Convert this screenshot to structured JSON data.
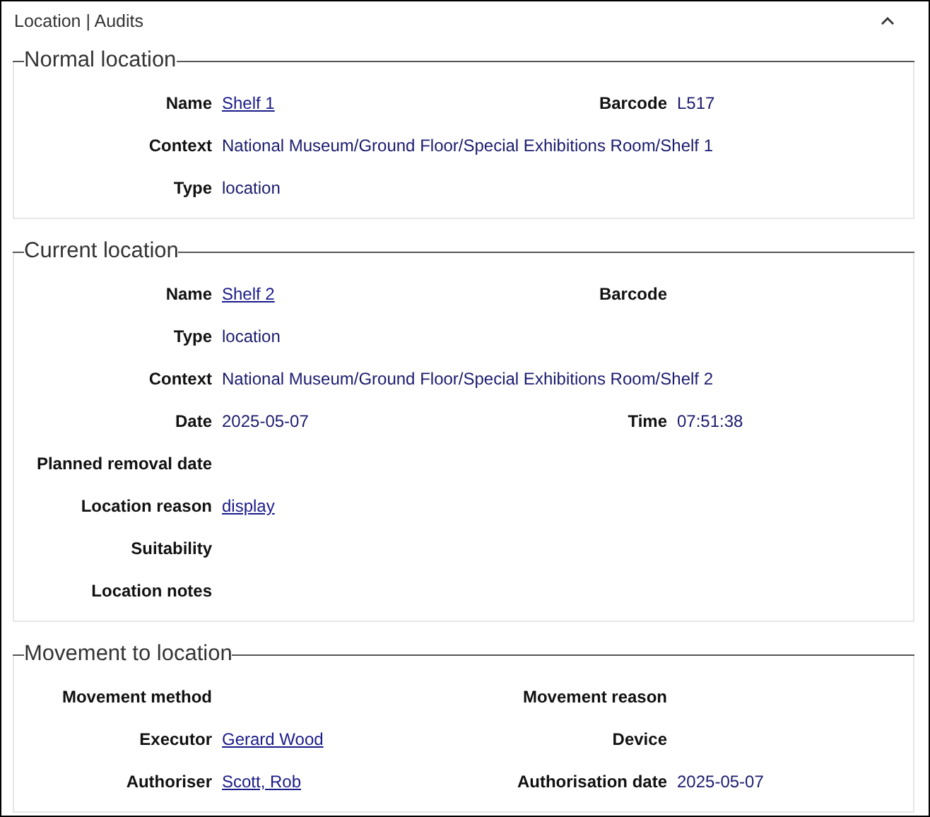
{
  "panel": {
    "title": "Location | Audits",
    "expanded": true
  },
  "sections": [
    {
      "title": "Normal location",
      "rows": [
        [
          {
            "label": "Name",
            "value": "Shelf 1",
            "kind": "link"
          },
          {
            "label": "Barcode",
            "value": "L517",
            "kind": "text"
          }
        ],
        [
          {
            "label": "Context",
            "value": "National Museum/Ground Floor/Special Exhibitions Room/Shelf 1",
            "kind": "text"
          }
        ],
        [
          {
            "label": "Type",
            "value": "location",
            "kind": "text"
          }
        ]
      ]
    },
    {
      "title": "Current location",
      "rows": [
        [
          {
            "label": "Name",
            "value": "Shelf 2",
            "kind": "link"
          },
          {
            "label": "Barcode"
          }
        ],
        [
          {
            "label": "Type",
            "value": "location",
            "kind": "text"
          }
        ],
        [
          {
            "label": "Context",
            "value": "National Museum/Ground Floor/Special Exhibitions Room/Shelf 2",
            "kind": "text"
          }
        ],
        [
          {
            "label": "Date",
            "value": "2025-05-07",
            "kind": "text"
          },
          {
            "label": "Time",
            "value": "07:51:38",
            "kind": "text"
          }
        ],
        [
          {
            "label": "Planned removal date"
          }
        ],
        [
          {
            "label": "Location reason",
            "value": "display",
            "kind": "link"
          }
        ],
        [
          {
            "label": "Suitability"
          }
        ],
        [
          {
            "label": "Location notes"
          }
        ]
      ]
    },
    {
      "title": "Movement to location",
      "rows": [
        [
          {
            "label": "Movement method"
          },
          {
            "label": "Movement reason"
          }
        ],
        [
          {
            "label": "Executor",
            "value": "Gerard Wood",
            "kind": "link"
          },
          {
            "label": "Device"
          }
        ],
        [
          {
            "label": "Authoriser",
            "value": "Scott, Rob",
            "kind": "link"
          },
          {
            "label": "Authorisation date",
            "value": "2025-05-07",
            "kind": "text"
          }
        ]
      ]
    }
  ]
}
